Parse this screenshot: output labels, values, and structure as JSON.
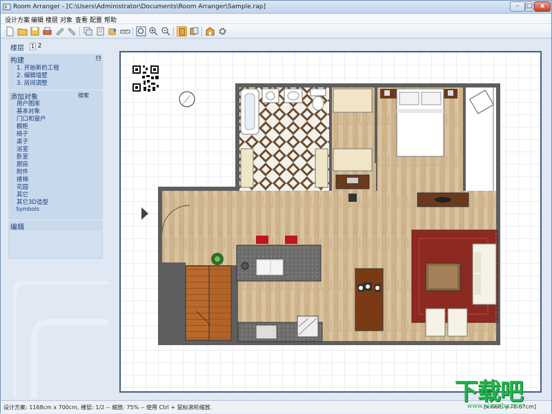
{
  "window": {
    "title": "Room Arranger - [C:\\Users\\Administrator\\Documents\\Room Arranger\\Sample.rap]",
    "controls": {
      "minimize": "–",
      "maximize": "□",
      "close": "x"
    }
  },
  "menubar": {
    "items": [
      "设计方案",
      "编辑",
      "楼层",
      "对象",
      "查看",
      "配置",
      "帮助"
    ]
  },
  "toolbar": {
    "icons": [
      "new-file-icon",
      "open-folder-icon",
      "save-icon",
      "print-icon",
      "undo-icon",
      "redo-icon",
      "copy-icon",
      "paste-icon",
      "export-icon",
      "measure-icon",
      "zoom-fit-icon",
      "zoom-in-icon",
      "zoom-out-icon",
      "view-2d-icon",
      "view-pages-icon",
      "view-3d-icon",
      "settings-gear-icon"
    ],
    "active": "view-2d-icon"
  },
  "sidebar": {
    "floors_label": "楼层",
    "floors": [
      "1",
      "2"
    ],
    "active_floor": "1",
    "build": {
      "title": "构建",
      "collapse": "⊟",
      "items": [
        "1. 开始新的工程",
        "2. 编辑墙壁",
        "3. 房间调整"
      ]
    },
    "add_objects": {
      "title": "添加对象",
      "search": "搜索",
      "items": [
        "用户图库",
        "基本对象",
        "门口和窗户",
        "橱柜",
        "椅子",
        "桌子",
        "浴室",
        "卧室",
        "厨房",
        "附件",
        "楼梯",
        "花园",
        "其它",
        "其它3D造型",
        "Symbols"
      ]
    },
    "edit": {
      "title": "编辑"
    }
  },
  "statusbar": {
    "text": "设计方案: 1168cm x 700cm, 楼层: 1/2 -- 缩放: 75% -- 使用 Ctrl + 鼠标滚轮缩放.",
    "coords": "[x:668, y:78.67cm]"
  },
  "watermark": {
    "main": "下载吧",
    "sub": "www.xiazaiba.com"
  },
  "colors": {
    "wall": "#5e5e5e",
    "wood_floor": "#d6bf9c",
    "tile_dark": "#6b4b2c",
    "rug": "#8c2a22",
    "title_gradient": "#bfd3ea",
    "accent_selected": "#f7d68f"
  }
}
